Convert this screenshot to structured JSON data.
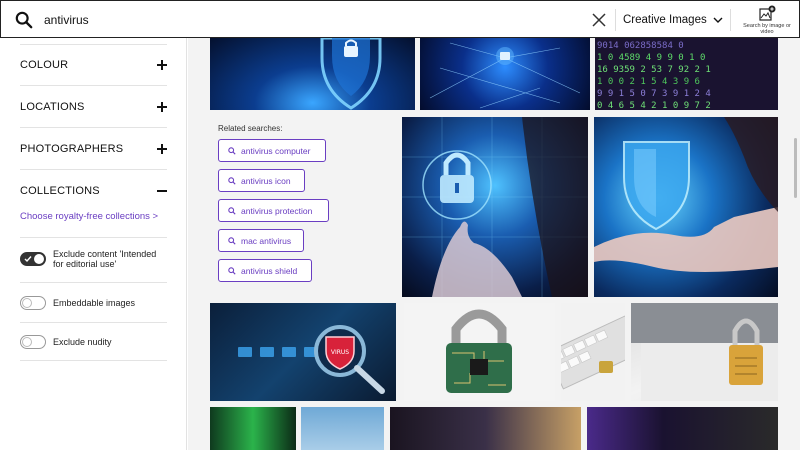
{
  "search": {
    "query": "antivirus",
    "type_label": "Creative Images",
    "reverse_label": "Search by image or video"
  },
  "sidebar": {
    "filters": [
      {
        "label": "COLOUR",
        "state": "collapsed"
      },
      {
        "label": "LOCATIONS",
        "state": "collapsed"
      },
      {
        "label": "PHOTOGRAPHERS",
        "state": "collapsed"
      },
      {
        "label": "COLLECTIONS",
        "state": "expanded"
      }
    ],
    "collections_link": "Choose royalty-free collections >",
    "toggles": [
      {
        "label": "Exclude content 'Intended for editorial use'",
        "on": true
      },
      {
        "label": "Embeddable images",
        "on": false
      },
      {
        "label": "Exclude nudity",
        "on": false
      }
    ]
  },
  "related": {
    "title": "Related searches:",
    "items": [
      "antivirus computer",
      "antivirus icon",
      "antivirus protection",
      "mac antivirus",
      "antivirus shield"
    ]
  },
  "images": [
    {
      "name": "shield-lock-blue",
      "theme": "shield"
    },
    {
      "name": "network-lock",
      "theme": "network"
    },
    {
      "name": "binary-code-green",
      "theme": "code"
    },
    {
      "name": "hand-touch-padlock",
      "theme": "padlock"
    },
    {
      "name": "hand-holding-shield",
      "theme": "shield"
    },
    {
      "name": "virus-magnifier-folders",
      "theme": "virus",
      "badge": "VIRUS"
    },
    {
      "name": "circuit-board-padlock",
      "theme": "circuit"
    },
    {
      "name": "keyboard-padlock",
      "theme": "keyboard"
    },
    {
      "name": "laptop-gold-padlock",
      "theme": "laptop"
    },
    {
      "name": "green-server",
      "theme": "server"
    },
    {
      "name": "blue-sky",
      "theme": "sky"
    },
    {
      "name": "hooded-hacker",
      "theme": "hacker"
    },
    {
      "name": "dark-code-screen",
      "theme": "code"
    }
  ],
  "colors": {
    "accent": "#6a3ec2",
    "border": "#222222",
    "grid_bg": "#f3f3f3"
  }
}
